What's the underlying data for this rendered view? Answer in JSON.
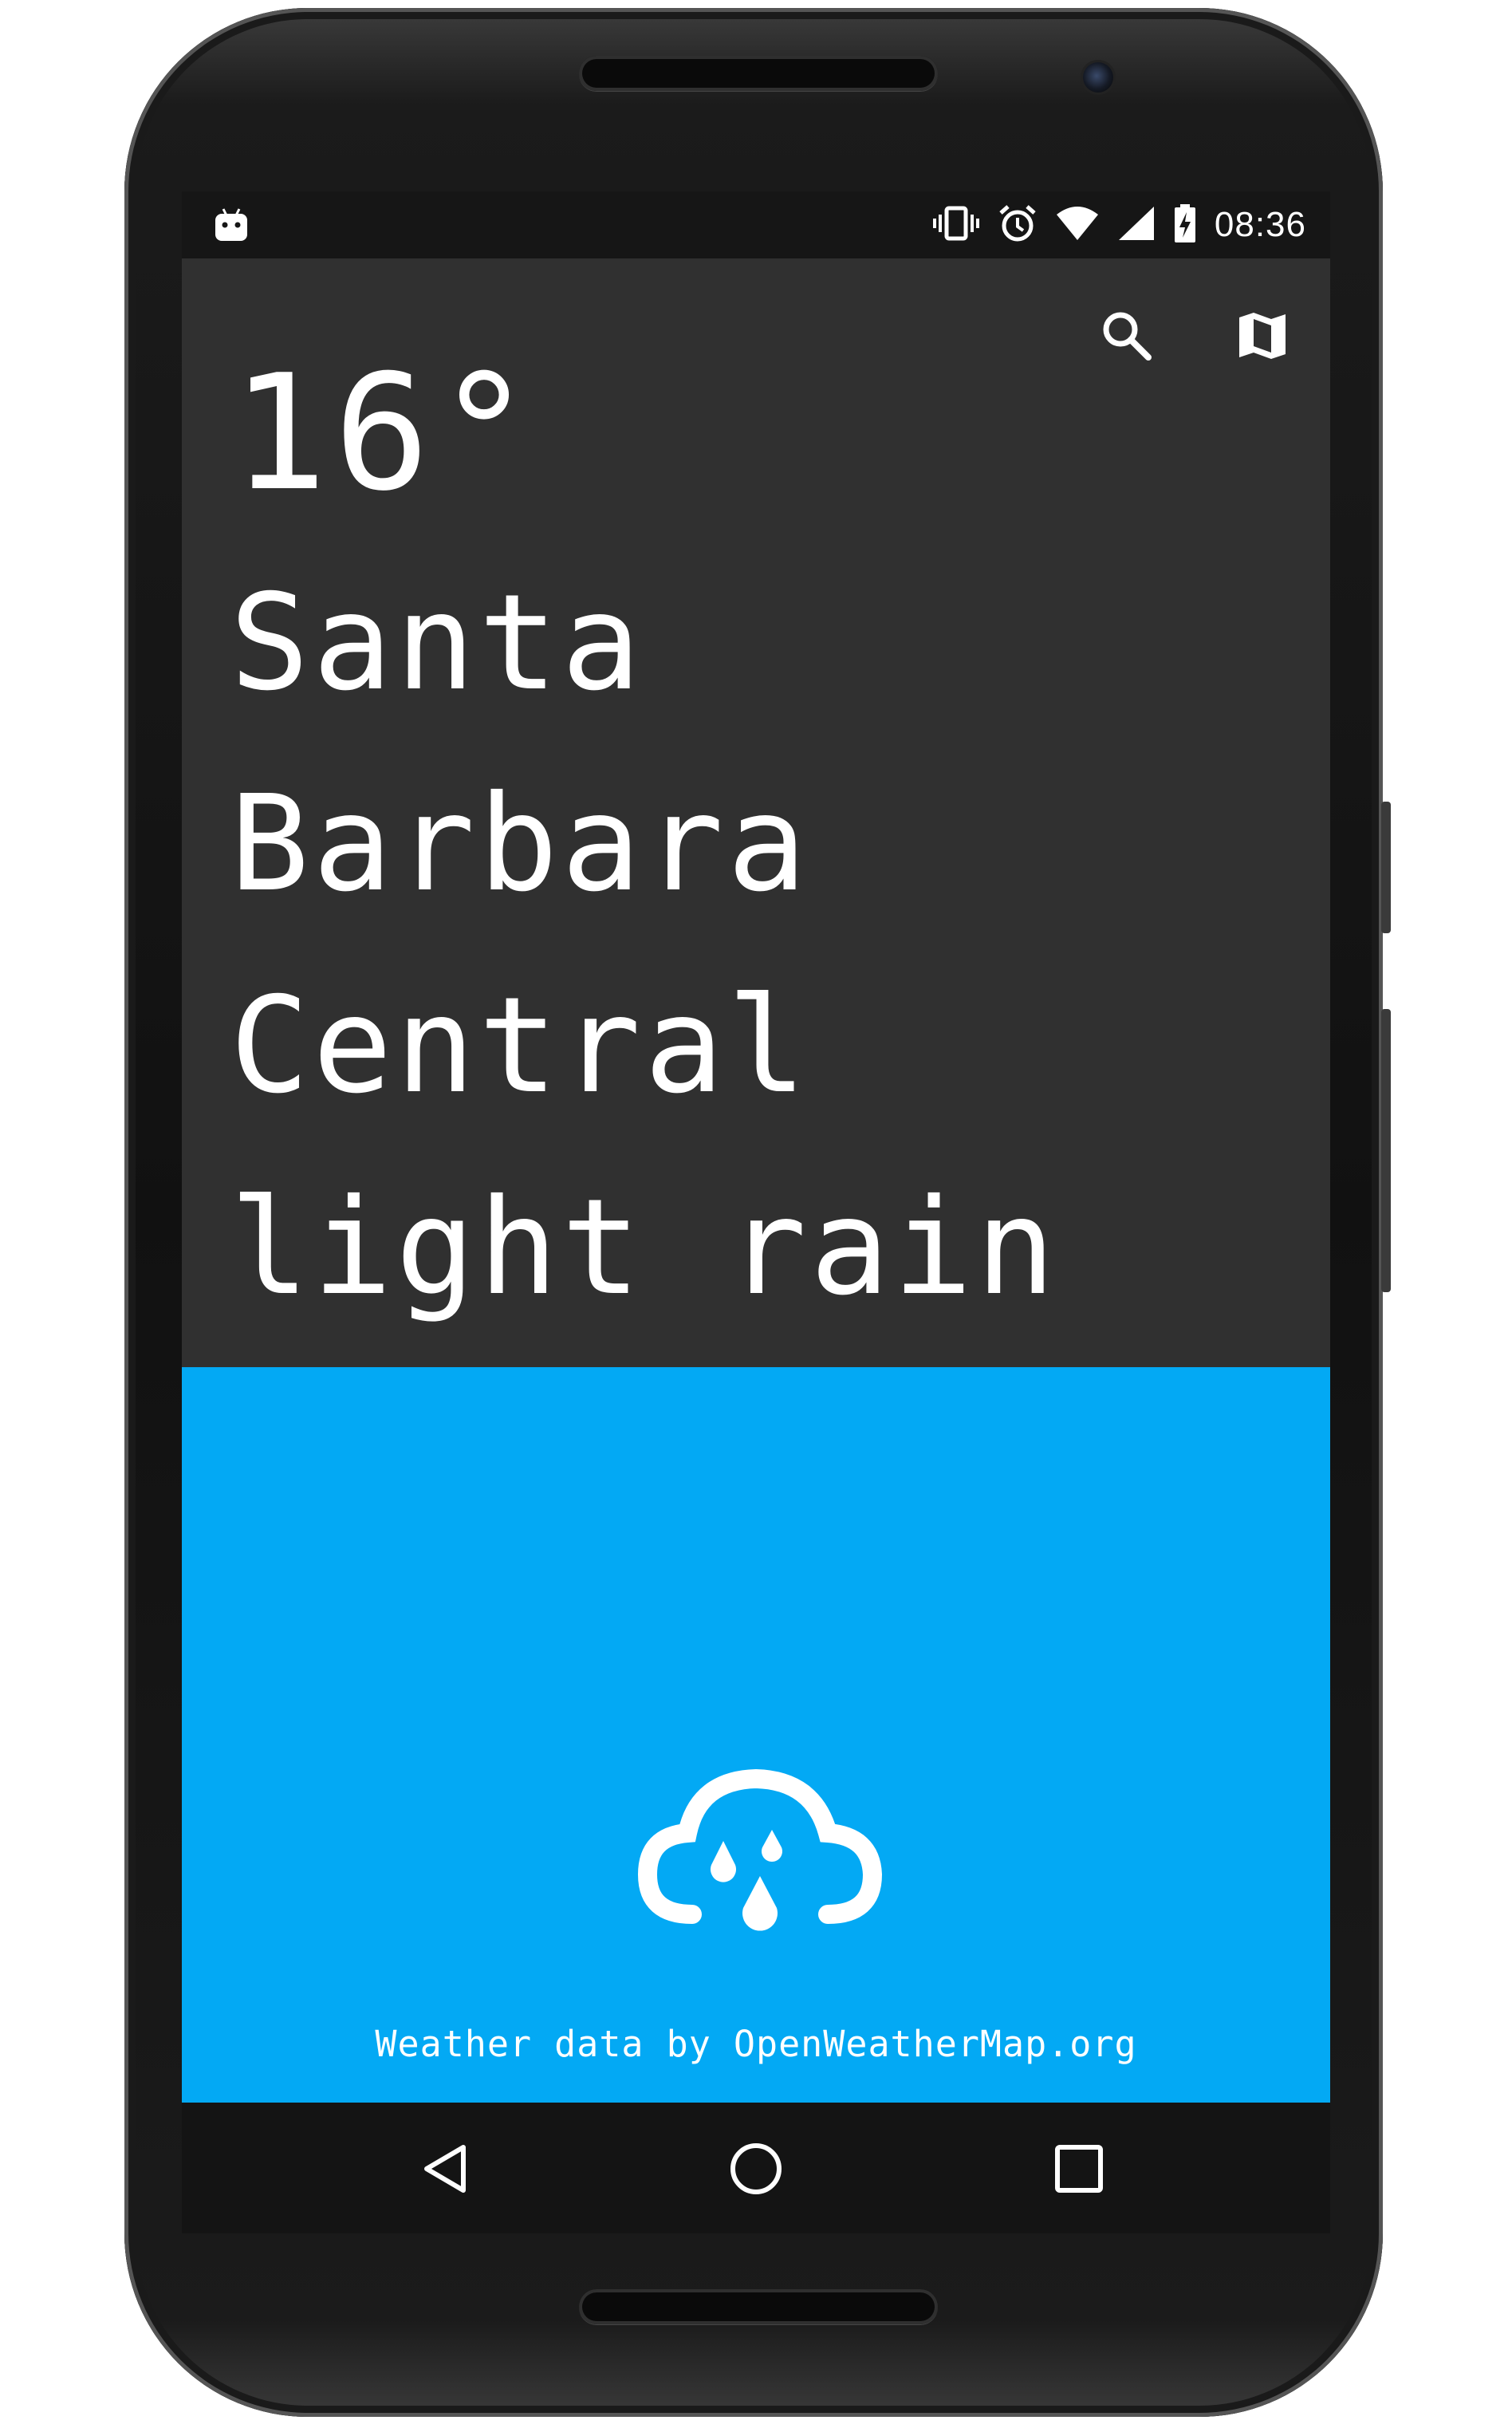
{
  "status_bar": {
    "time": "08:36",
    "left_icon": "android-debug-icon",
    "icons": [
      "vibrate-icon",
      "alarm-icon",
      "wifi-icon",
      "cell-signal-icon",
      "battery-charging-icon"
    ]
  },
  "toolbar": {
    "actions": [
      "search-icon",
      "map-icon"
    ]
  },
  "weather": {
    "temperature": "16°",
    "city_line_1": "Santa",
    "city_line_2": "Barbara",
    "city_line_3": "Central",
    "description": "light rain",
    "condition_icon": "cloud-rain-icon"
  },
  "footer": {
    "credit": "Weather data by OpenWeatherMap.org"
  },
  "navigation": {
    "buttons": [
      "back-icon",
      "home-icon",
      "recents-icon"
    ]
  },
  "colors": {
    "background": "#303030",
    "accent": "#03a9f4",
    "text": "#ffffff",
    "status_bar": "#161616",
    "nav_bar": "#141414"
  }
}
